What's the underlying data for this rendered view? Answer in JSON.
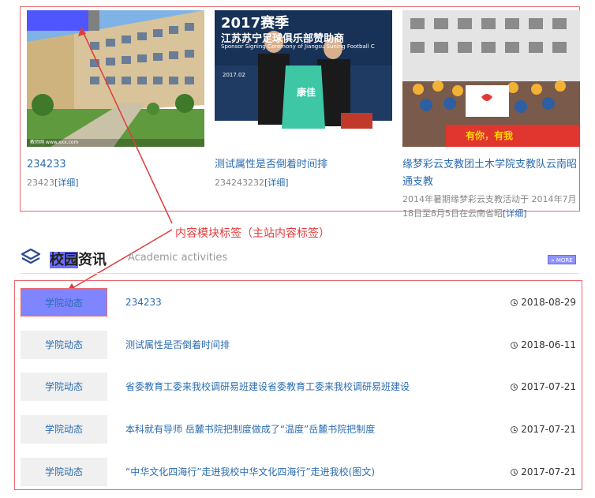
{
  "cards": [
    {
      "title": "234233",
      "desc": "23423",
      "more": "[详细]",
      "img_caption": "教师网 www.xxx.com"
    },
    {
      "title": "测试属性是否倒着时间排",
      "desc": "234243232",
      "more": "[详细]",
      "img_headline": "2017赛季",
      "img_line2": "江苏苏宁足球俱乐部赞助商",
      "img_line3": "Sponsor Signing Ceremony of Jiangsu Suning Football C",
      "jersey_text": "康佳",
      "img_date": "2017.02"
    },
    {
      "title": "缘梦彩云支教团土木学院支教队云南昭通支教",
      "desc": "2014年暑期缘梦彩云支教活动于 2014年7月18日至8月5日在云南省昭",
      "more": "[详细]",
      "banner_text": "有你，有我"
    }
  ],
  "annotation": {
    "label": "内容模块标签（主站内容标签）"
  },
  "section": {
    "title_hl1": "校园",
    "title_rest": "资讯",
    "subtitle": "Academic activities",
    "more": "» MORE"
  },
  "news": [
    {
      "tag": "学院动态",
      "title": "234233",
      "date": "2018-08-29"
    },
    {
      "tag": "学院动态",
      "title": "测试属性是否倒着时间排",
      "date": "2018-06-11"
    },
    {
      "tag": "学院动态",
      "title": "省委教育工委来我校调研易班建设省委教育工委来我校调研易班建设",
      "date": "2017-07-21"
    },
    {
      "tag": "学院动态",
      "title": "本科就有导师 岳麓书院把制度做成了“温度”岳麓书院把制度",
      "date": "2017-07-21"
    },
    {
      "tag": "学院动态",
      "title": "“中华文化四海行”走进我校中华文化四海行”走进我校(图文)",
      "date": "2017-07-21"
    }
  ],
  "colors": {
    "accent": "#2b6cb0",
    "annotation": "#e8676d",
    "highlight": "#6a6dff"
  }
}
